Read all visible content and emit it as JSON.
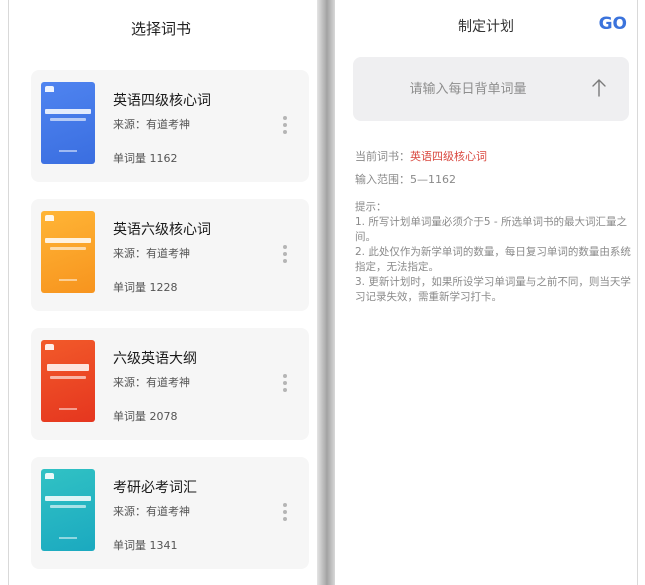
{
  "left": {
    "title": "选择词书",
    "books": [
      {
        "name": "英语四级核心词",
        "source": "来源：有道考神",
        "count": "单词量  1162",
        "cover_color": "#4f84f0"
      },
      {
        "name": "英语六级核心词",
        "source": "来源：有道考神",
        "count": "单词量  1228",
        "cover_color": "#f7941e"
      },
      {
        "name": "六级英语大纲",
        "source": "来源：有道考神",
        "count": "单词量  2078",
        "cover_color": "#e5361f"
      },
      {
        "name": "考研必考词汇",
        "source": "来源：有道考神",
        "count": "单词量  1341",
        "cover_color": "#1ba9c0"
      }
    ]
  },
  "right": {
    "title": "制定计划",
    "go_label": "GO",
    "input_placeholder": "请输入每日背单词量",
    "current_book_label": "当前词书：",
    "current_book_value": "英语四级核心词",
    "range_label": "输入范围：",
    "range_value": "5—1162",
    "tips_title": "提示：",
    "tips": [
      "1. 所写计划单词量必须介于5 - 所选单词书的最大词汇量之间。",
      "2. 此处仅作为新学单词的数量，每日复习单词的数量由系统指定，无法指定。",
      "3. 更新计划时，如果所设学习单词量与之前不同，则当天学习记录失效，需重新学习打卡。"
    ]
  },
  "colors": {
    "accent": "#3b73dc",
    "highlight": "#d9473e",
    "card_bg": "#f6f6f6",
    "input_bg": "#efeff1"
  }
}
